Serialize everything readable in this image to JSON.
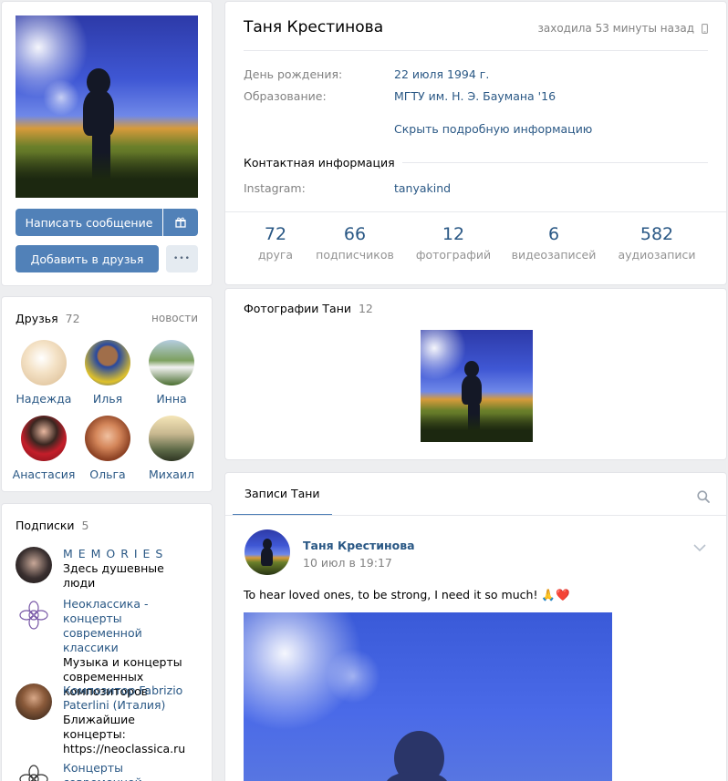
{
  "profile": {
    "name": "Таня Крестинова",
    "last_seen": "заходила 53 минуты назад",
    "send_message": "Написать сообщение",
    "add_friend": "Добавить в друзья",
    "more": "•••",
    "info": [
      {
        "label": "День рождения:",
        "value": "22 июля 1994 г."
      },
      {
        "label": "Образование:",
        "value": "МГТУ им. Н. Э. Баумана '16"
      }
    ],
    "hide_details": "Скрыть подробную информацию",
    "contacts_title": "Контактная информация",
    "instagram_label": "Instagram:",
    "instagram_value": "tanyakind",
    "stats": [
      {
        "num": "72",
        "cap": "друга"
      },
      {
        "num": "66",
        "cap": "подписчиков"
      },
      {
        "num": "12",
        "cap": "фотографий"
      },
      {
        "num": "6",
        "cap": "видеозаписей"
      },
      {
        "num": "582",
        "cap": "аудиозаписи"
      }
    ]
  },
  "friends": {
    "title": "Друзья",
    "count": "72",
    "link": "новости",
    "items": [
      {
        "name": "Надежда",
        "color": "#e8d9c4"
      },
      {
        "name": "Илья",
        "color": "#3a5aa8"
      },
      {
        "name": "Инна",
        "color": "#6f9a58"
      },
      {
        "name": "Анастасия",
        "color": "#b22a2a"
      },
      {
        "name": "Ольга",
        "color": "#c4723a"
      },
      {
        "name": "Михаил",
        "color": "#8d9a7a"
      }
    ]
  },
  "subscriptions": {
    "title": "Подписки",
    "count": "5",
    "items": [
      {
        "title": "M E M O R I E S",
        "desc": "Здесь душевные люди",
        "color": "#3a3536"
      },
      {
        "title": "Неоклассика - концерты современной классики",
        "desc": "Музыка и концерты современных композиторов",
        "color": "#ffffff"
      },
      {
        "title": "Композитор Fabrizio Paterlini (Италия)",
        "desc": "Ближайшие концерты: https://neoclassica.ru",
        "color": "#6a4a34"
      },
      {
        "title": "Концерты современной",
        "desc": "",
        "color": "#ffffff"
      }
    ]
  },
  "photos": {
    "title": "Фотографии Тани",
    "count": "12"
  },
  "wall": {
    "tab": "Записи Тани",
    "post_author": "Таня Крестинова",
    "post_date": "10 июл в 19:17",
    "post_text": "To hear loved ones, to be strong, I need it so much! 🙏❤️"
  },
  "colors": {
    "accent": "#5181b8",
    "link": "#2a5885",
    "bg": "#edeef0"
  }
}
